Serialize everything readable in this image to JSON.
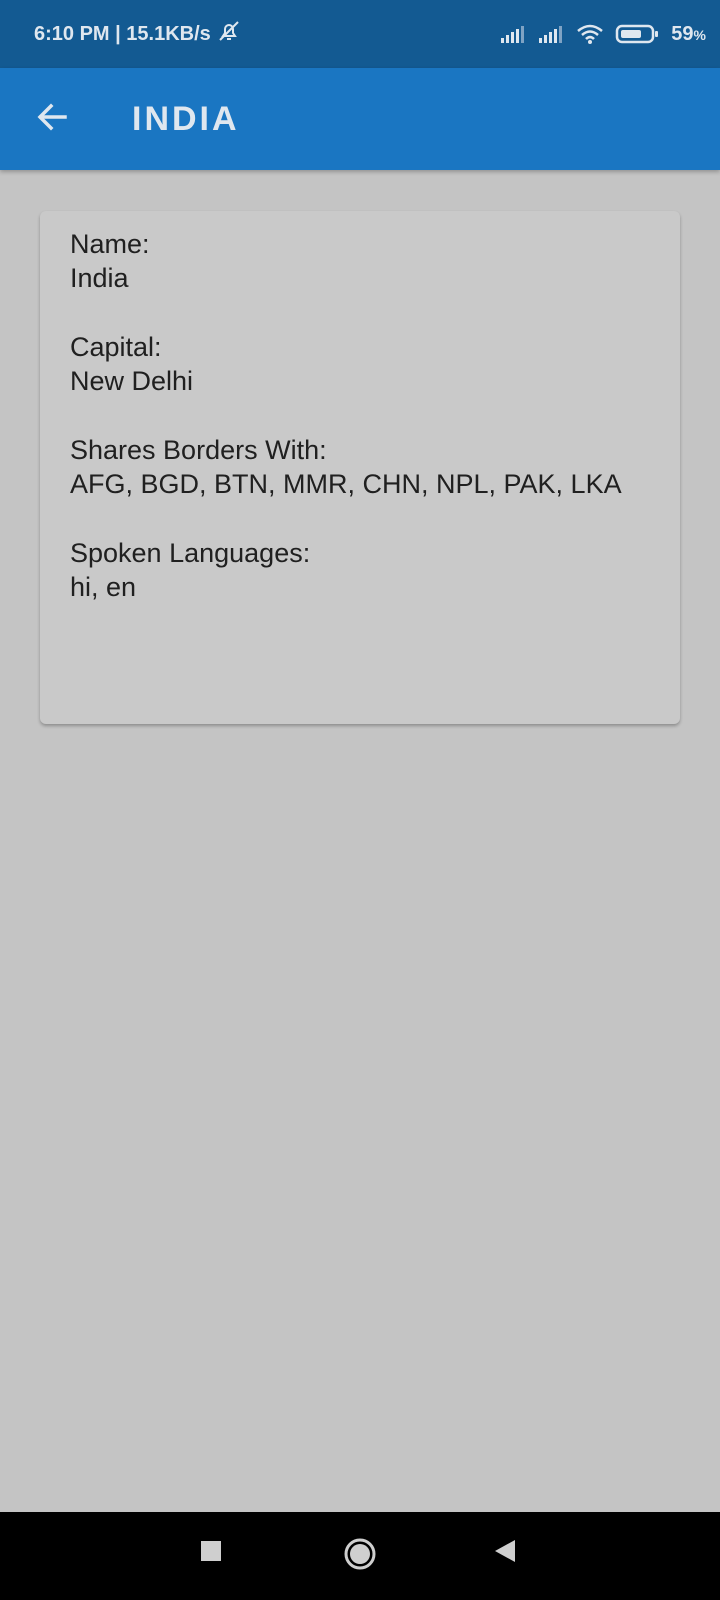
{
  "status_bar": {
    "time_speed": "6:10 PM | 15.1KB/s",
    "battery": "59",
    "battery_unit": "%",
    "icons": [
      "bell-off-icon",
      "signal-icon",
      "signal-icon",
      "wifi-icon",
      "battery-icon"
    ]
  },
  "app_bar": {
    "title": "INDIA",
    "back_icon": "arrow-left-icon"
  },
  "details": {
    "name_label": "Name:",
    "name_value": "India",
    "capital_label": "Capital:",
    "capital_value": "New Delhi",
    "borders_label": "Shares Borders With:",
    "borders_value": "AFG, BGD, BTN, MMR, CHN, NPL, PAK, LKA",
    "languages_label": "Spoken Languages:",
    "languages_value": "hi, en"
  },
  "nav_bar": {
    "icons": [
      "recents-square-icon",
      "home-circle-icon",
      "back-triangle-icon"
    ]
  },
  "colors": {
    "status_bar": "#135a92",
    "app_bar": "#1a76c2",
    "background": "#c4c4c4",
    "card": "#c9c9c9"
  }
}
